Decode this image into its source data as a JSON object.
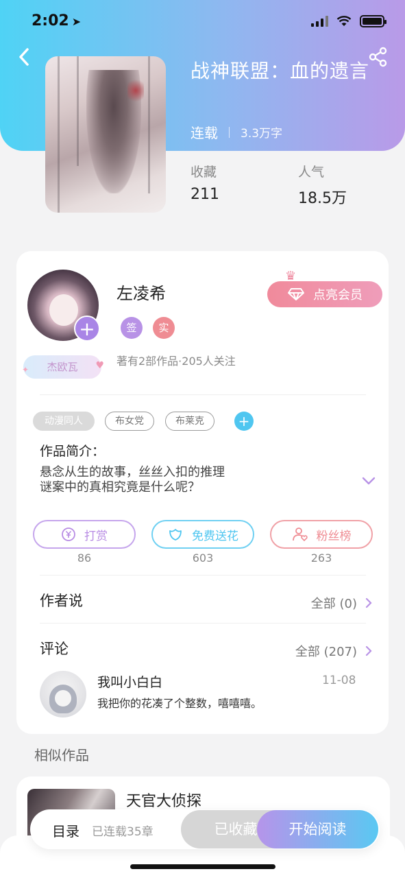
{
  "status_bar": {
    "time": "2:02"
  },
  "book": {
    "title": "战神联盟：血的遗言",
    "status": "连载",
    "word_count": "3.3万字",
    "stats": [
      {
        "label": "收藏",
        "value": "211"
      },
      {
        "label": "人气",
        "value": "18.5万"
      }
    ]
  },
  "author": {
    "name": "左凌希",
    "badge": "杰欧瓦",
    "tags": [
      "签",
      "实"
    ],
    "info": "著有2部作品·205人关注",
    "vip_button": "点亮会员"
  },
  "genre_tags": [
    "动漫同人",
    "布女党",
    "布莱克"
  ],
  "intro": {
    "title": "作品简介：",
    "text_line1": "悬念从生的故事，丝丝入扣的推理",
    "text_line2": "谜案中的真相究竟是什么呢？"
  },
  "actions": [
    {
      "label": "打赏",
      "count": "86",
      "color": "#b88ce4"
    },
    {
      "label": "免费送花",
      "count": "603",
      "color": "#4fc6f0"
    },
    {
      "label": "粉丝榜",
      "count": "263",
      "color": "#ef8c93"
    }
  ],
  "author_says": {
    "title": "作者说",
    "more": "全部 (0)"
  },
  "comments": {
    "title": "评论",
    "more": "全部 (207)",
    "items": [
      {
        "user": "我叫小白白",
        "date": "11-08",
        "text": "我把你的花凑了个整数，嘻嘻嘻。"
      }
    ]
  },
  "similar": {
    "title": "相似作品",
    "items": [
      {
        "name": "天官大侦探"
      }
    ]
  },
  "bottom_bar": {
    "toc": "目录",
    "chapters": "已连载35章",
    "favorited": "已收藏",
    "start_reading": "开始阅读"
  }
}
